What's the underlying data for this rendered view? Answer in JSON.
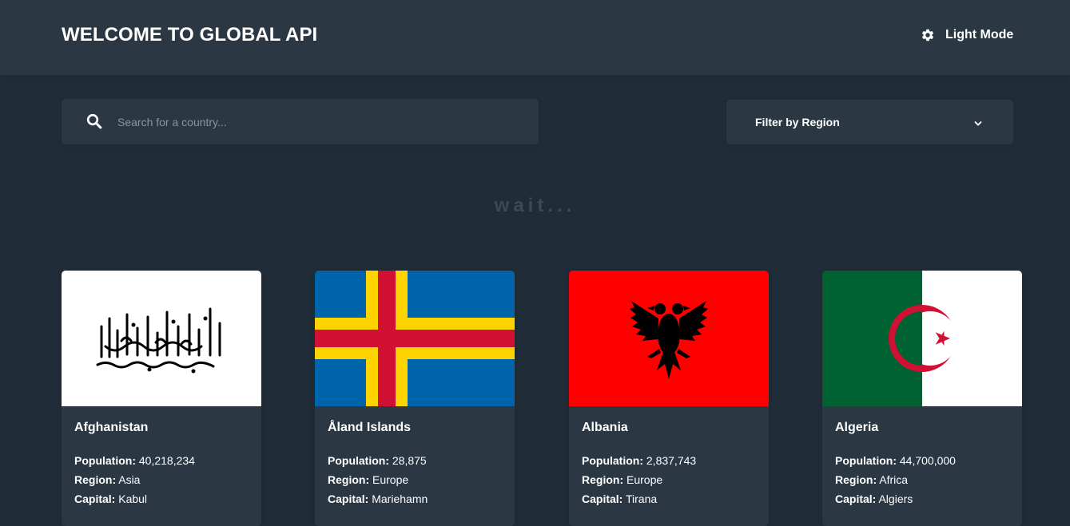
{
  "header": {
    "title": "WELCOME TO GLOBAL API",
    "theme_toggle_label": "Light Mode",
    "theme_toggle_icon": "gear-icon"
  },
  "search": {
    "placeholder": "Search for a country...",
    "value": "",
    "icon": "search-icon"
  },
  "filter": {
    "label": "Filter by Region",
    "icon": "chevron-down-icon"
  },
  "loading_text": "wait...",
  "labels": {
    "population": "Population:",
    "region": "Region:",
    "capital": "Capital:"
  },
  "countries": [
    {
      "name": "Afghanistan",
      "population": "40,218,234",
      "region": "Asia",
      "capital": "Kabul",
      "flag": "afghanistan-flag"
    },
    {
      "name": "Åland Islands",
      "population": "28,875",
      "region": "Europe",
      "capital": "Mariehamn",
      "flag": "aland-islands-flag"
    },
    {
      "name": "Albania",
      "population": "2,837,743",
      "region": "Europe",
      "capital": "Tirana",
      "flag": "albania-flag"
    },
    {
      "name": "Algeria",
      "population": "44,700,000",
      "region": "Africa",
      "capital": "Algiers",
      "flag": "algeria-flag"
    }
  ],
  "colors": {
    "background": "#202c37",
    "surface": "#2b3844",
    "text": "#ffffff",
    "muted_text": "#3d4956"
  }
}
